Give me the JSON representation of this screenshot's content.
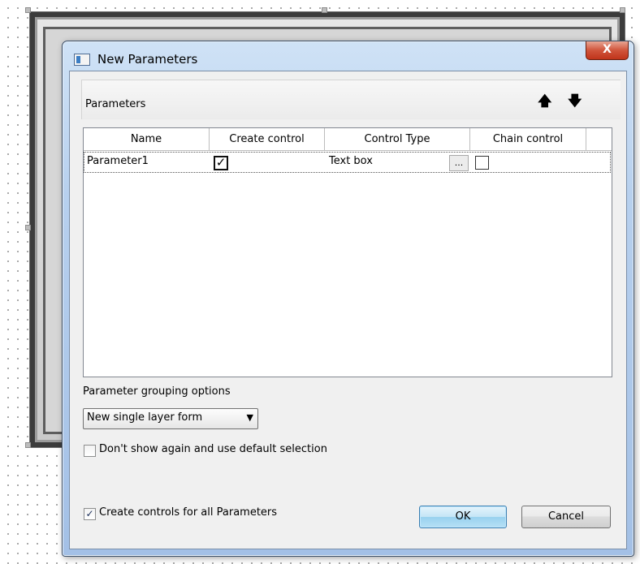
{
  "dialog": {
    "title": "New Parameters",
    "close_label": "X"
  },
  "params_header": {
    "title": "Parameters",
    "move_up_glyph": "🡅",
    "move_down_glyph": "🡇"
  },
  "grid": {
    "columns": [
      "Name",
      "Create control",
      "Control Type",
      "Chain control"
    ],
    "rows": [
      {
        "name": "Parameter1",
        "create_control": true,
        "control_type": "Text box",
        "ellipsis": "...",
        "chain_control": false
      }
    ]
  },
  "grouping": {
    "label": "Parameter grouping options",
    "selected": "New single layer form",
    "dropdown_glyph": "▼"
  },
  "dont_show": {
    "label": "Don't show again and use default selection",
    "checked": false
  },
  "create_all": {
    "label": "Create controls for all Parameters",
    "checked": true,
    "check_glyph": "✓"
  },
  "buttons": {
    "ok": "OK",
    "cancel": "Cancel"
  },
  "icons": {
    "dialog_icon": "form-window-icon",
    "move_up": "arrow-up-icon",
    "move_down": "arrow-down-icon",
    "dropdown": "chevron-down-icon"
  },
  "colors": {
    "titlebar": "#b7d0ee",
    "close": "#c0341a",
    "ok_button": "#98d1ef"
  }
}
